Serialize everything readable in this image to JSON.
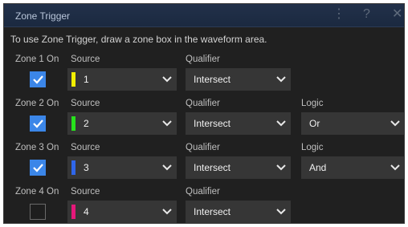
{
  "dialog": {
    "title": "Zone Trigger",
    "icons": [
      "vertical-dots-icon",
      "help-icon",
      "close-icon"
    ],
    "instruction": "To use Zone Trigger, draw a zone box in the waveform area."
  },
  "zones": [
    {
      "label": "Zone 1 On",
      "checked": true,
      "source_label": "Source",
      "source": "1",
      "source_color": "#f2ef00",
      "qualifier_label": "Qualifier",
      "qualifier": "Intersect"
    },
    {
      "label": "Zone 2 On",
      "checked": true,
      "source_label": "Source",
      "source": "2",
      "source_color": "#27e21c",
      "qualifier_label": "Qualifier",
      "qualifier": "Intersect",
      "logic_label": "Logic",
      "logic": "Or"
    },
    {
      "label": "Zone 3 On",
      "checked": true,
      "source_label": "Source",
      "source": "3",
      "source_color": "#2f66ea",
      "qualifier_label": "Qualifier",
      "qualifier": "Intersect",
      "logic_label": "Logic",
      "logic": "And"
    },
    {
      "label": "Zone 4 On",
      "checked": false,
      "source_label": "Source",
      "source": "4",
      "source_color": "#e5187a",
      "qualifier_label": "Qualifier",
      "qualifier": "Intersect"
    }
  ],
  "colors": {
    "checkbox_on": "#3b86e8",
    "dropdown_bg": "#363636",
    "dialog_bg": "#202020"
  }
}
